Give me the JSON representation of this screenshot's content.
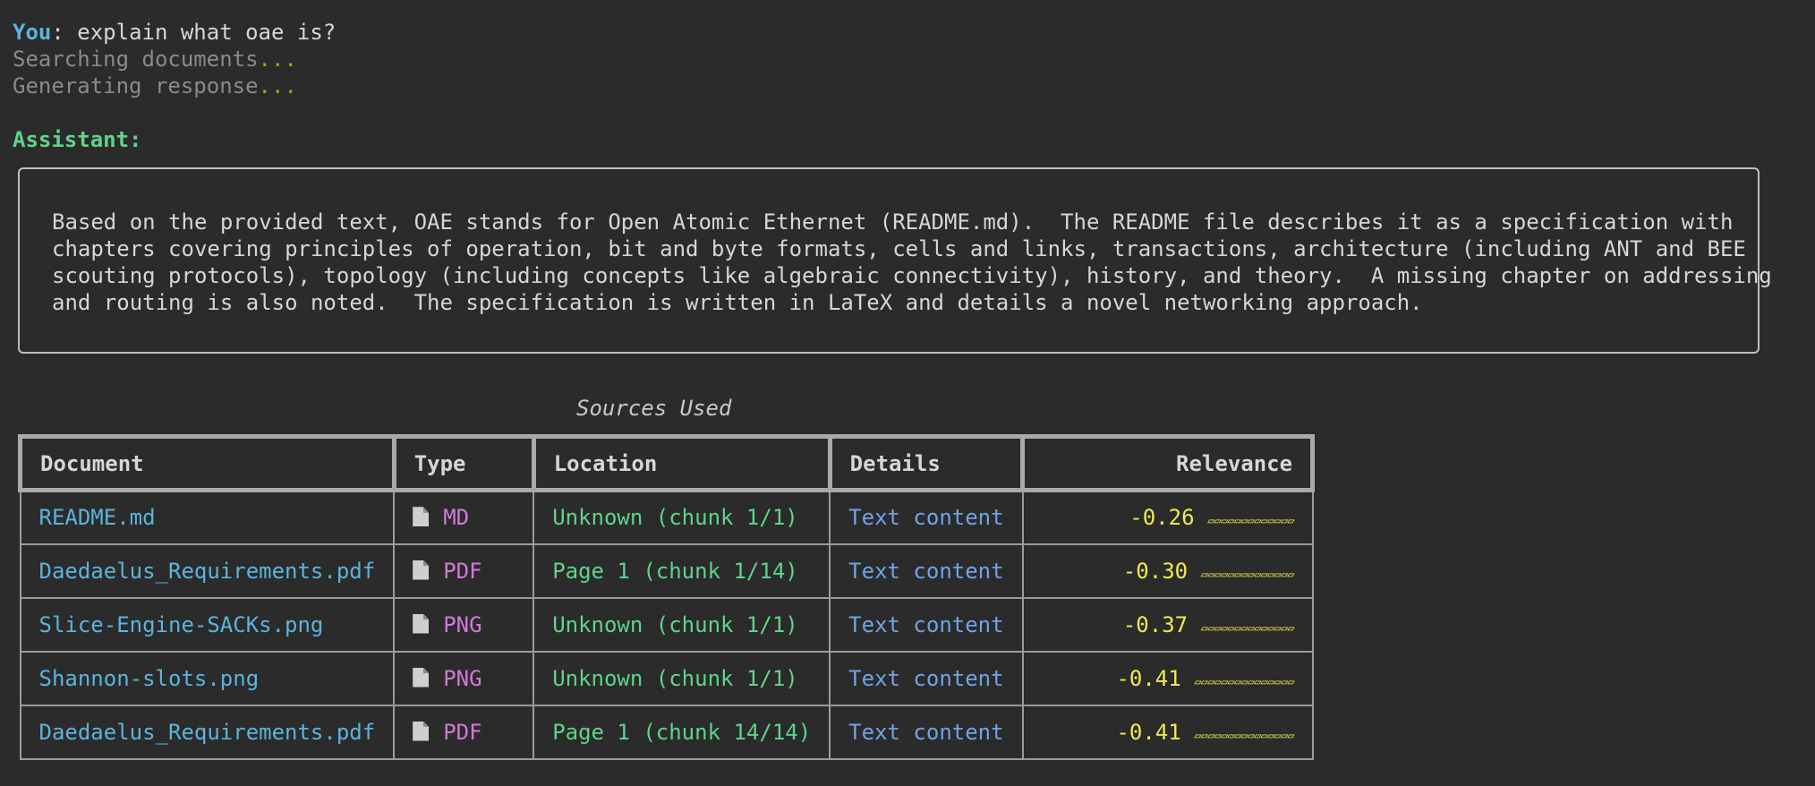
{
  "chat": {
    "user_label": "You",
    "user_message": "explain what oae is?",
    "status1": "Searching documents",
    "status2": "Generating response",
    "ellipsis": "...",
    "assistant_label": "Assistant:",
    "response_lines": [
      "Based on the provided text, OAE stands for Open Atomic Ethernet (README.md).  The README file describes it as a specification with",
      "chapters covering principles of operation, bit and byte formats, cells and links, transactions, architecture (including ANT and BEE",
      "scouting protocols), topology (including concepts like algebraic connectivity), history, and theory.  A missing chapter on addressing",
      "and routing is also noted.  The specification is written in LaTeX and details a novel networking approach."
    ]
  },
  "sources": {
    "caption": "Sources Used",
    "headers": [
      "Document",
      "Type",
      "Location",
      "Details",
      "Relevance"
    ],
    "rows": [
      {
        "document": "README.md",
        "type": "MD",
        "location": "Unknown (chunk 1/1)",
        "details": "Text content",
        "relevance": "-0.26",
        "bar": "▱▱▱▱▱▱▱▱▱▱▱▱▱"
      },
      {
        "document": "Daedaelus_Requirements.pdf",
        "type": "PDF",
        "location": "Page 1 (chunk 1/14)",
        "details": "Text content",
        "relevance": "-0.30",
        "bar": "▱▱▱▱▱▱▱▱▱▱▱▱▱▱"
      },
      {
        "document": "Slice-Engine-SACKs.png",
        "type": "PNG",
        "location": "Unknown (chunk 1/1)",
        "details": "Text content",
        "relevance": "-0.37",
        "bar": "▱▱▱▱▱▱▱▱▱▱▱▱▱▱"
      },
      {
        "document": "Shannon-slots.png",
        "type": "PNG",
        "location": "Unknown (chunk 1/1)",
        "details": "Text content",
        "relevance": "-0.41",
        "bar": "▱▱▱▱▱▱▱▱▱▱▱▱▱▱▱"
      },
      {
        "document": "Daedaelus_Requirements.pdf",
        "type": "PDF",
        "location": "Page 1 (chunk 14/14)",
        "details": "Text content",
        "relevance": "-0.41",
        "bar": "▱▱▱▱▱▱▱▱▱▱▱▱▱▱▱"
      }
    ]
  },
  "colors": {
    "background": "#2b2b2b",
    "user": "#5ab4dc",
    "assistant": "#5fd38a",
    "relevance": "#f2e94e"
  },
  "icons": {
    "type_icon": "file-icon"
  }
}
